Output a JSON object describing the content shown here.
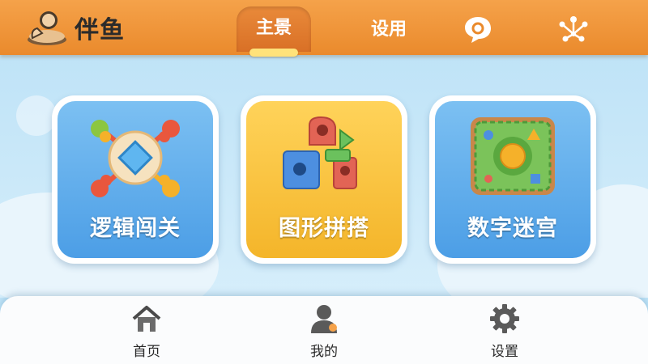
{
  "app": {
    "name": "伴鱼"
  },
  "topnav": {
    "tabs": [
      {
        "label": "主景",
        "active": true
      },
      {
        "label": "设用",
        "active": false
      }
    ],
    "icons": [
      "chat-bubble-icon",
      "network-icon"
    ]
  },
  "cards": [
    {
      "label": "逻辑闯关",
      "icon": "logic-puzzle-icon",
      "color": "#4c9ee6"
    },
    {
      "label": "图形拼搭",
      "icon": "building-blocks-icon",
      "color": "#f4b52a"
    },
    {
      "label": "数字迷宫",
      "icon": "maze-board-icon",
      "color": "#4c9ee6"
    }
  ],
  "bottomnav": {
    "items": [
      {
        "label": "首页",
        "icon": "house-icon"
      },
      {
        "label": "我的",
        "icon": "user-icon"
      },
      {
        "label": "设置",
        "icon": "gear-icon"
      }
    ]
  },
  "colors": {
    "accent": "#ea8a2c",
    "tab_indicator": "#ffe27a",
    "background": "#bfe4f8"
  }
}
